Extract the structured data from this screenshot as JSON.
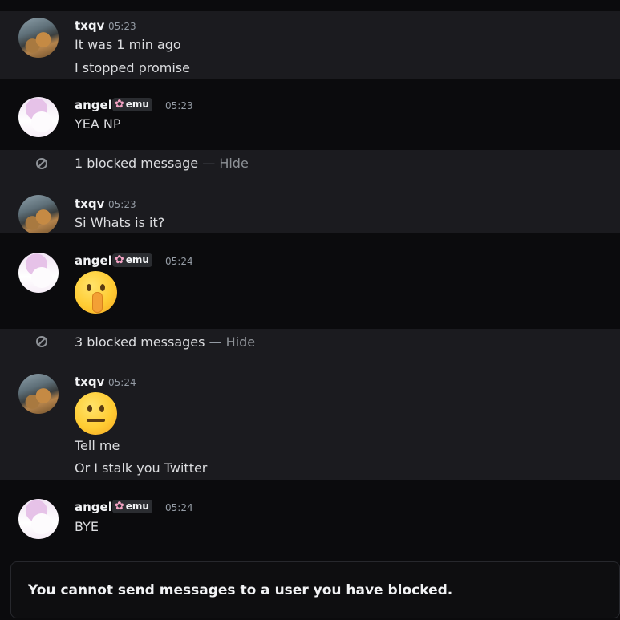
{
  "messages": [
    {
      "author": "txqv",
      "time": "05:23",
      "lines": [
        "It was 1 min ago",
        "I stopped promise"
      ]
    },
    {
      "author": "angel",
      "tag": "emu",
      "time": "05:23",
      "lines": [
        "YEA NP"
      ]
    },
    {
      "blocked": "1 blocked message",
      "hide": "Hide"
    },
    {
      "author": "txqv",
      "time": "05:23",
      "lines": [
        "Si Whats is it?"
      ]
    },
    {
      "author": "angel",
      "tag": "emu",
      "time": "05:24",
      "emoji": "shushing-face"
    },
    {
      "blocked": "3 blocked messages",
      "hide": "Hide"
    },
    {
      "author": "txqv",
      "time": "05:24",
      "emoji": "neutral-face",
      "lines": [
        "Tell me",
        "Or I stalk you Twitter"
      ]
    },
    {
      "author": "angel",
      "tag": "emu",
      "time": "05:24",
      "lines": [
        "BYE"
      ]
    }
  ],
  "composer": {
    "notice": "You cannot send messages to a user you have blocked."
  },
  "separator": " — ",
  "tag_icon": "sakura-flower-icon"
}
